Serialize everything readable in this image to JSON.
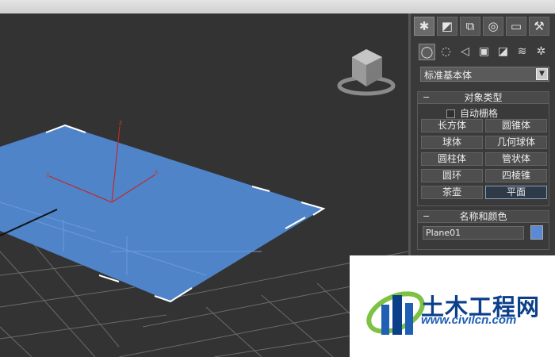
{
  "colors": {
    "plane": "#4f84c9",
    "panel_bg": "#3a3a3a",
    "viewport_bg": "#333333",
    "accent_swatch": "#5a8ad6"
  },
  "viewport": {
    "axis_labels": {
      "z": "z",
      "x": "x",
      "y": "y"
    },
    "gizmo": "viewcube-icon"
  },
  "command_panel": {
    "tabs": [
      {
        "icon": "create-icon",
        "glyph": "✱"
      },
      {
        "icon": "modify-icon",
        "glyph": "◩"
      },
      {
        "icon": "hierarchy-icon",
        "glyph": "⧉"
      },
      {
        "icon": "motion-icon",
        "glyph": "◎"
      },
      {
        "icon": "display-icon",
        "glyph": "▭"
      },
      {
        "icon": "utilities-icon",
        "glyph": "⚒"
      }
    ],
    "categories": [
      {
        "icon": "geometry-icon",
        "glyph": "◯"
      },
      {
        "icon": "shapes-icon",
        "glyph": "◌"
      },
      {
        "icon": "lights-icon",
        "glyph": "◁"
      },
      {
        "icon": "cameras-icon",
        "glyph": "▣"
      },
      {
        "icon": "helpers-icon",
        "glyph": "◪"
      },
      {
        "icon": "spacewarps-icon",
        "glyph": "≋"
      },
      {
        "icon": "systems-icon",
        "glyph": "✲"
      }
    ],
    "dropdown_value": "标准基本体",
    "object_type": {
      "title": "对象类型",
      "autogrid": "自动栅格",
      "buttons": [
        "长方体",
        "圆锥体",
        "球体",
        "几何球体",
        "圆柱体",
        "管状体",
        "圆环",
        "四棱锥",
        "茶壶",
        "平面"
      ]
    },
    "name_color": {
      "title": "名称和颜色",
      "name_value": "Plane01"
    }
  },
  "watermark": {
    "title": "土木工程网",
    "url": "www.civilcn.com"
  }
}
